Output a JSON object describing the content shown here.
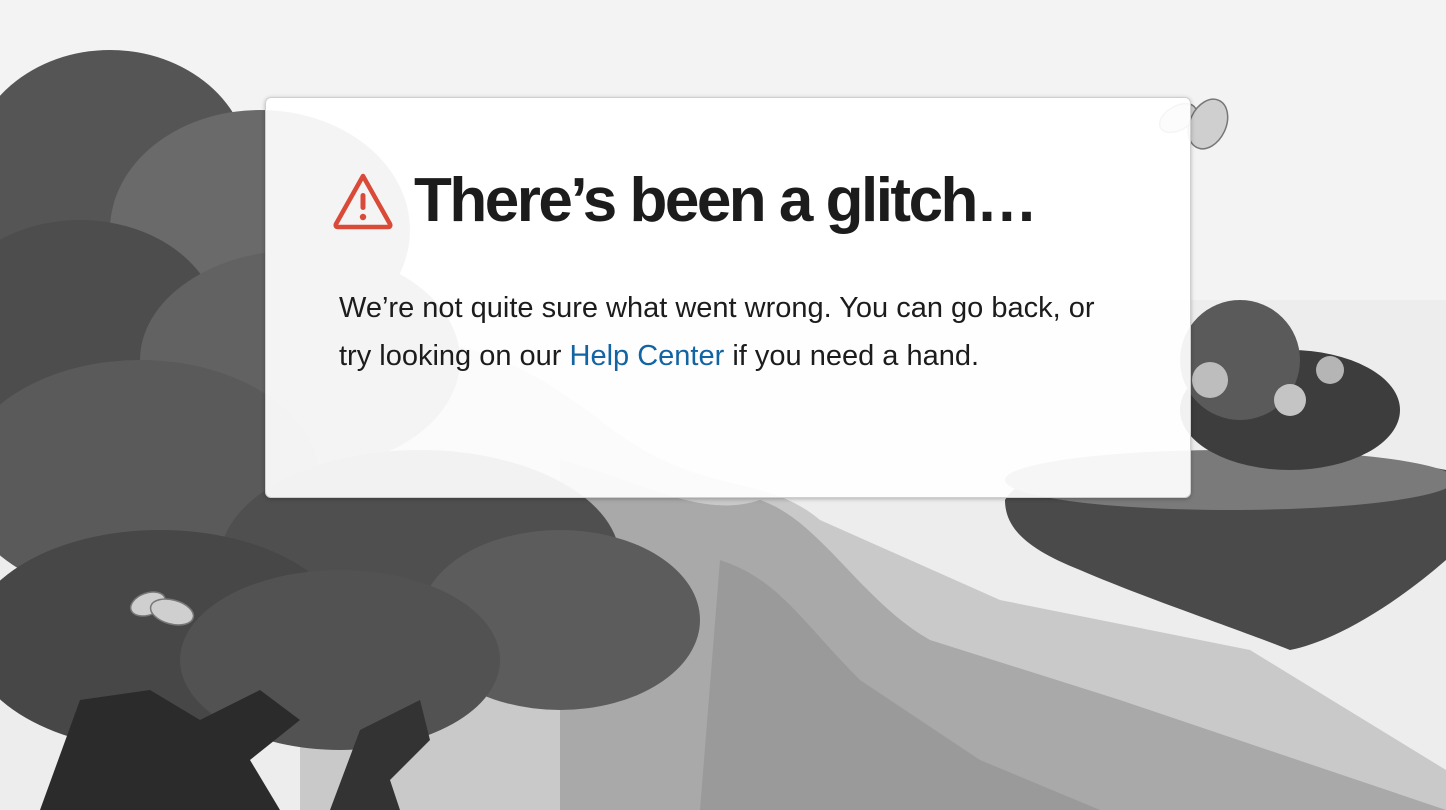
{
  "error": {
    "title": "There’s been a glitch…",
    "message_before_link": "We’re not quite sure what went wrong. You can go back, or try looking on our ",
    "link_text": "Help Center",
    "message_after_link": " if you need a hand.",
    "icon": "warning-triangle-icon"
  },
  "colors": {
    "warning_icon": "#d94a38",
    "link": "#1264a3",
    "text": "#1d1c1d",
    "background": "#efefef"
  }
}
